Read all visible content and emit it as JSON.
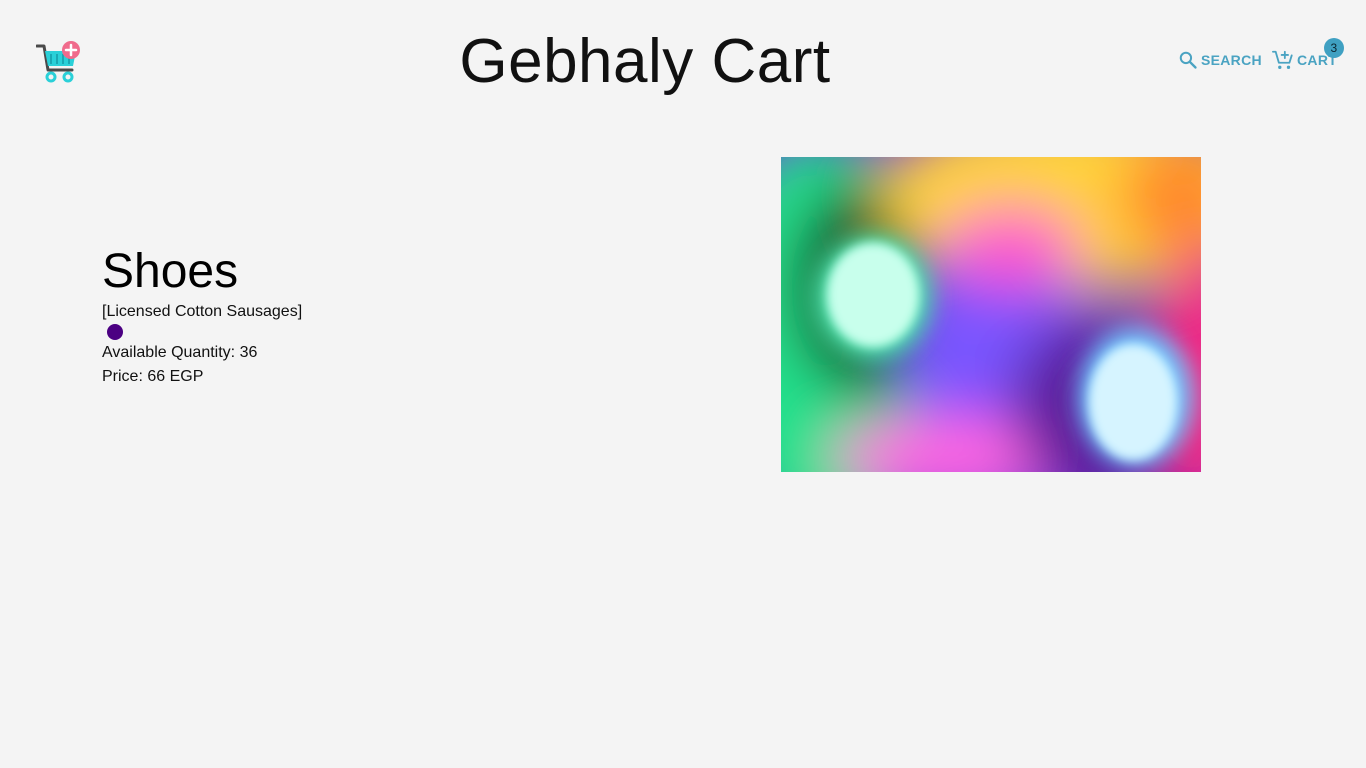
{
  "header": {
    "title": "Gebhaly Cart",
    "logo_icon": "cart-plus-logo-icon",
    "search": {
      "label": "SEARCH",
      "icon": "search-icon"
    },
    "cart": {
      "label": "CART",
      "icon": "add-shopping-cart-icon",
      "badge_count": "3"
    }
  },
  "product": {
    "name": "Shoes",
    "tags": "[Licensed Cotton Sausages]",
    "color": "#4b0082",
    "quantity_text": "Available Quantity: 36",
    "price_text": "Price: 66 EGP",
    "image_description_icon": "product-image"
  },
  "colors": {
    "accent": "#4aa3c2",
    "badge": "#3fa0c2",
    "background": "#f4f4f4"
  }
}
